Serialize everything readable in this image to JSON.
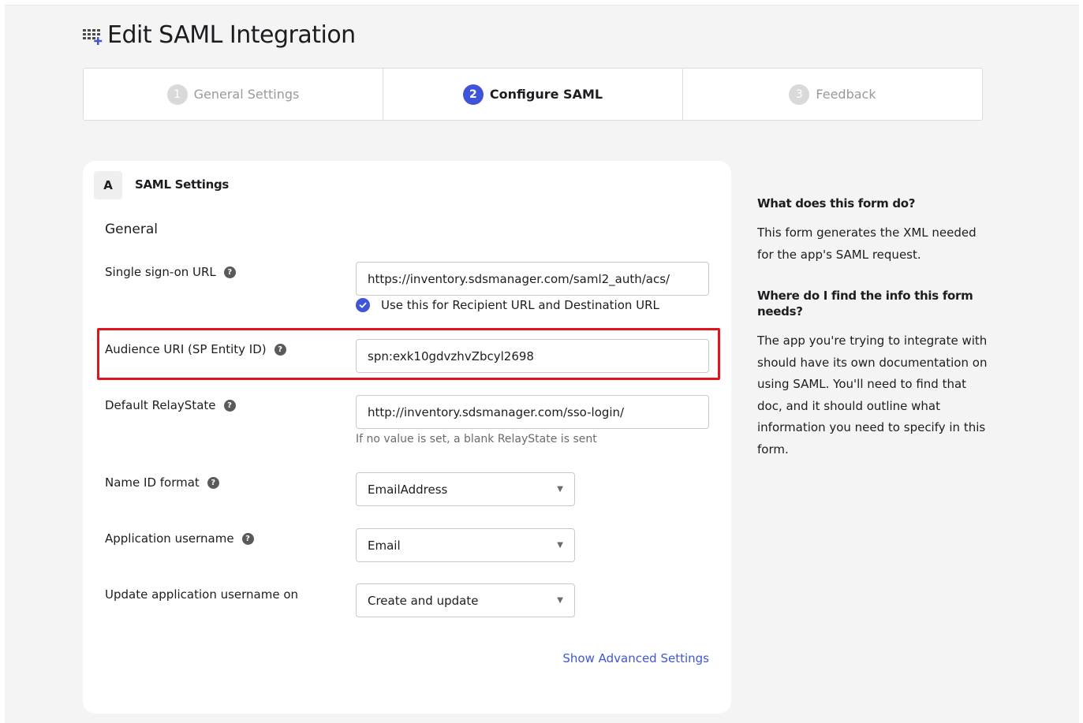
{
  "page": {
    "title": "Edit SAML Integration"
  },
  "steps": [
    {
      "number": "1",
      "label": "General Settings",
      "state": "inactive"
    },
    {
      "number": "2",
      "label": "Configure SAML",
      "state": "active"
    },
    {
      "number": "3",
      "label": "Feedback",
      "state": "inactive"
    }
  ],
  "section": {
    "badge": "A",
    "title": "SAML Settings",
    "group": "General"
  },
  "fields": {
    "sso_url": {
      "label": "Single sign-on URL",
      "value": "https://inventory.sdsmanager.com/saml2_auth/acs/"
    },
    "recipient_checkbox": {
      "label": "Use this for Recipient URL and Destination URL",
      "checked": true
    },
    "audience_uri": {
      "label": "Audience URI (SP Entity ID)",
      "value": "spn:exk10gdvzhvZbcyl2698"
    },
    "relay_state": {
      "label": "Default RelayState",
      "value": "http://inventory.sdsmanager.com/sso-login/",
      "hint": "If no value is set, a blank RelayState is sent"
    },
    "name_id_format": {
      "label": "Name ID format",
      "value": "EmailAddress"
    },
    "app_username": {
      "label": "Application username",
      "value": "Email"
    },
    "update_username_on": {
      "label": "Update application username on",
      "value": "Create and update"
    }
  },
  "advanced_link": "Show Advanced Settings",
  "aside": {
    "q1": "What does this form do?",
    "a1": "This form generates the XML needed for the app's SAML request.",
    "q2": "Where do I find the info this form needs?",
    "a2": "The app you're trying to integrate with should have its own documentation on using SAML. You'll need to find that doc, and it should outline what information you need to specify in this form."
  },
  "colors": {
    "accent": "#3e56d6",
    "highlight": "#e0141e",
    "background": "#f4f4f4"
  },
  "icons": {
    "title": "app-grid-plus-icon",
    "help": "help-circle-icon",
    "check": "check-icon",
    "caret": "caret-down-icon"
  }
}
